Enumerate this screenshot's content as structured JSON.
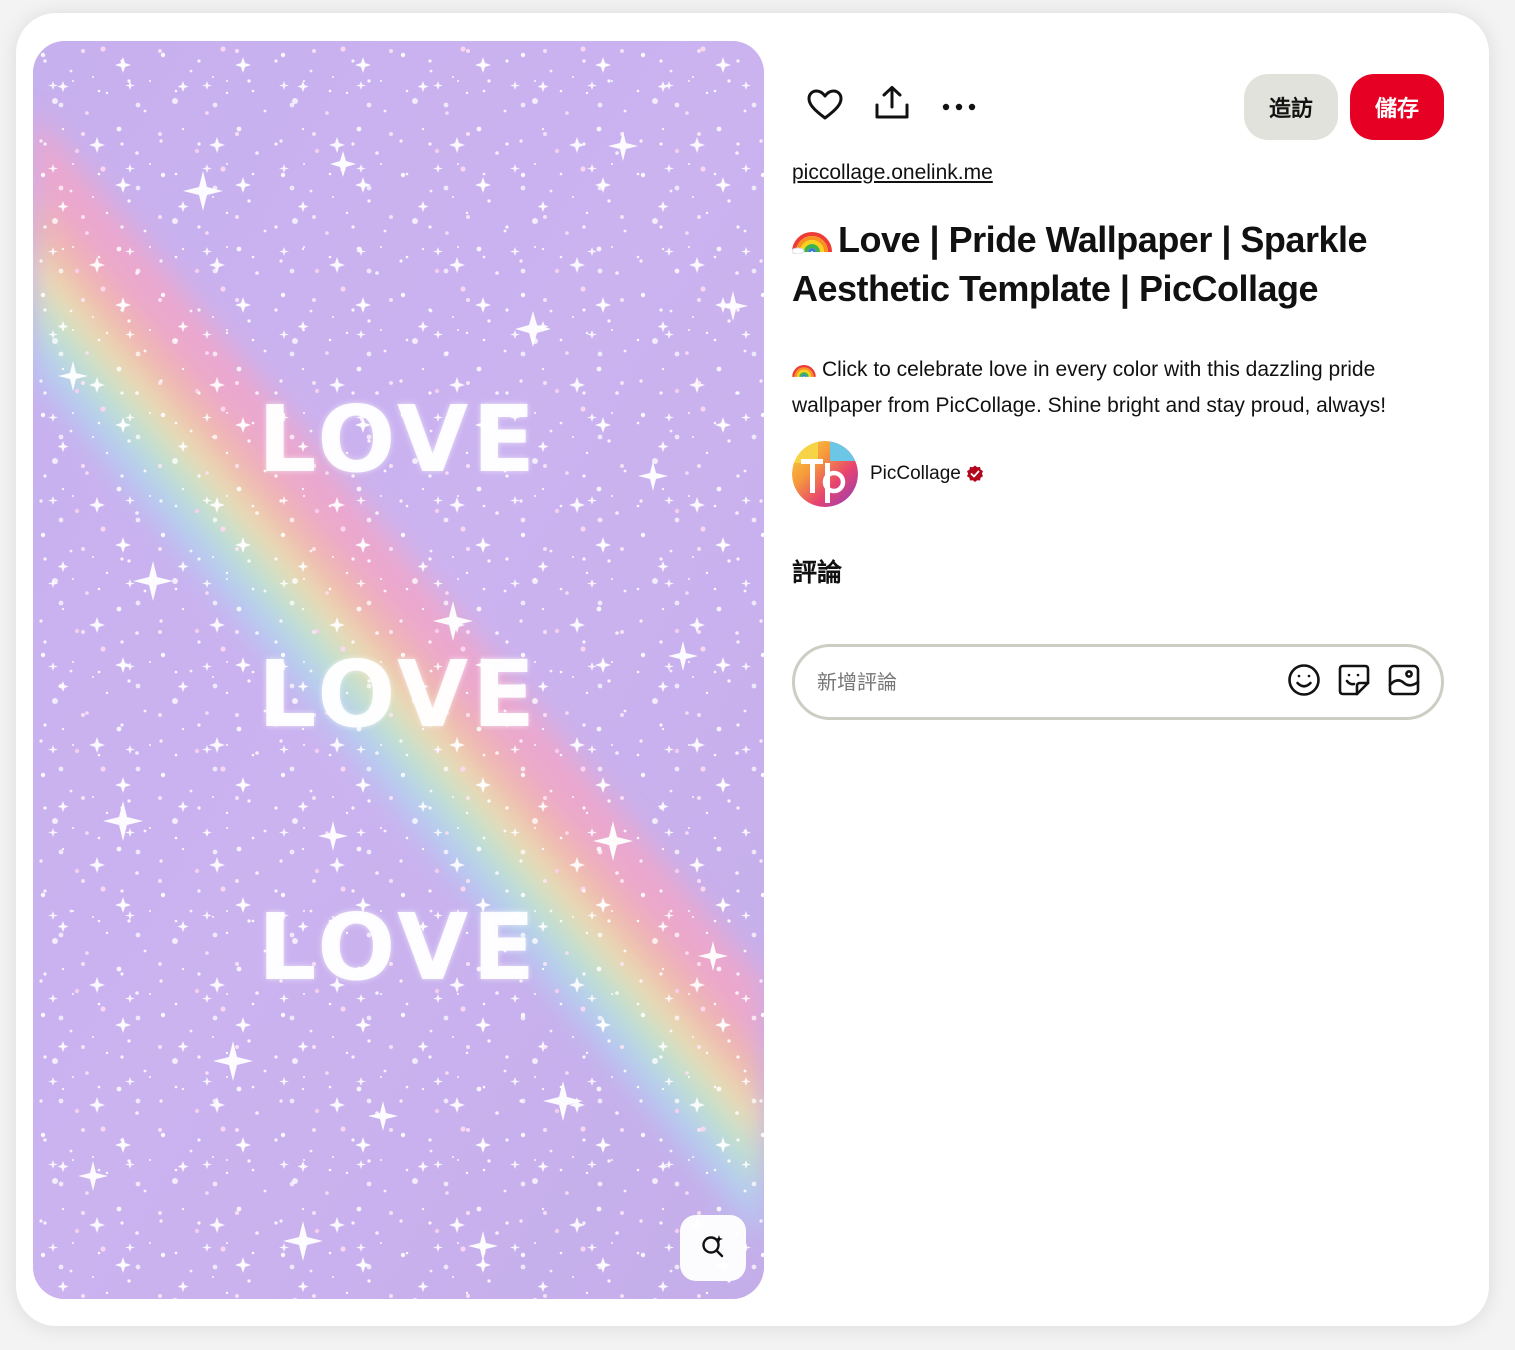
{
  "pin": {
    "image": {
      "overlay_words": [
        "LOVE",
        "LOVE",
        "LOVE"
      ],
      "background_color": "#c9b1ee",
      "lens_icon": "visual-search-icon"
    },
    "actions": {
      "like_icon": "heart-icon",
      "share_icon": "share-upload-icon",
      "more_icon": "ellipsis-icon",
      "visit_label": "造訪",
      "save_label": "儲存"
    },
    "source_link": "piccollage.onelink.me",
    "title": "Love | Pride Wallpaper | Sparkle Aesthetic Template | PicCollage",
    "title_prefix_icon": "rainbow-icon",
    "description": "Click to celebrate love in every color with this dazzling pride wallpaper from PicCollage. Shine bright and stay proud, always!",
    "creator": {
      "name": "PicCollage",
      "verified": true
    },
    "comments": {
      "heading": "評論",
      "placeholder": "新增評論",
      "tools": [
        "emoji-icon",
        "sticker-icon",
        "image-icon"
      ]
    }
  },
  "colors": {
    "save_red": "#e60023",
    "visit_gray": "#e2e2dc",
    "verified_red": "#b2061d",
    "border_gray": "#cdcdc4"
  }
}
